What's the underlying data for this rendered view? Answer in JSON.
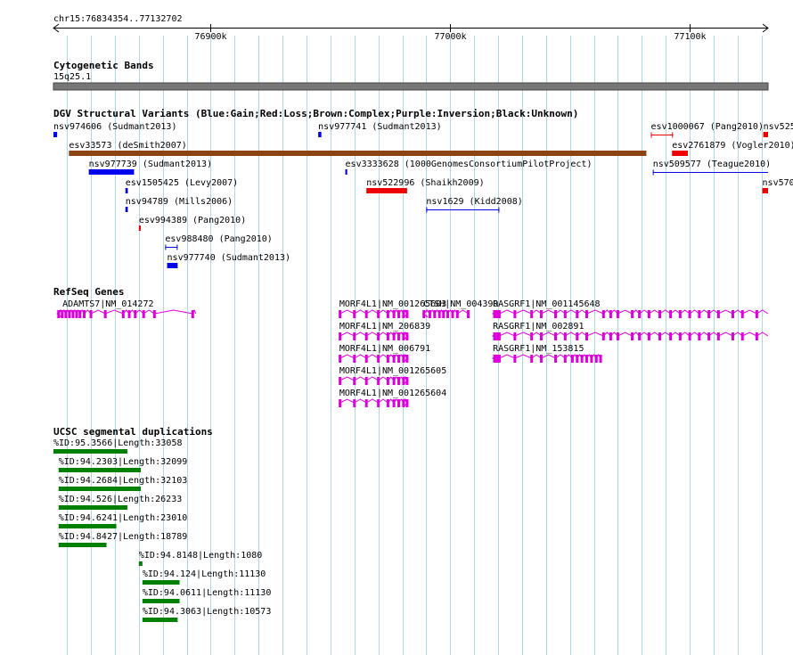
{
  "header": {
    "location": "chr15:76834354..77132702",
    "ticks": [
      {
        "pos": 76900000,
        "label": "76900k"
      },
      {
        "pos": 77000000,
        "label": "77000k"
      },
      {
        "pos": 77100000,
        "label": "77100k"
      }
    ]
  },
  "view": {
    "start": 76834354,
    "end": 77132702
  },
  "colors": {
    "gain": "#0000ee",
    "loss": "#ee0000",
    "complex": "#8b4513",
    "gene": "#dd00dd",
    "segdup": "#008000",
    "band": "#777777",
    "grid": "#add8e6"
  },
  "tracks": {
    "cyto": {
      "title": "Cytogenetic Bands",
      "band_label": "15q25.1"
    },
    "dgv": {
      "title": "DGV Structural Variants (Blue:Gain;Red:Loss;Brown:Complex;Purple:Inversion;Black:Unknown)",
      "features": [
        {
          "label": "nsv974606 (Sudmant2013)",
          "start": 76834354,
          "end": 76835900,
          "row": 0,
          "type": "gain",
          "style": "box"
        },
        {
          "label": "nsv977741 (Sudmant2013)",
          "start": 76944900,
          "end": 76946200,
          "row": 0,
          "type": "gain",
          "style": "box"
        },
        {
          "label": "esv1000067 (Pang2010)",
          "start": 77083800,
          "end": 77093000,
          "row": 0,
          "type": "loss",
          "style": "span"
        },
        {
          "label": "nsv525",
          "start": 77130700,
          "end": 77132702,
          "row": 0,
          "type": "loss",
          "style": "box"
        },
        {
          "label": "esv33573 (deSmith2007)",
          "start": 76840800,
          "end": 77081900,
          "row": 1,
          "type": "complex",
          "style": "box"
        },
        {
          "label": "esv2761879 (Vogler2010)",
          "start": 77092600,
          "end": 77099200,
          "row": 1,
          "type": "loss",
          "style": "box"
        },
        {
          "label": "nsv977739 (Sudmant2013)",
          "start": 76849100,
          "end": 76868000,
          "row": 2,
          "type": "gain",
          "style": "box"
        },
        {
          "label": "esv3333628 (1000GenomesConsortiumPilotProject)",
          "start": 76956200,
          "end": 76957000,
          "row": 2,
          "type": "gain",
          "style": "box"
        },
        {
          "label": "nsv509577 (Teague2010)",
          "start": 77084600,
          "end": 77132702,
          "row": 2,
          "type": "gain",
          "style": "span"
        },
        {
          "label": "esv1505425 (Levy2007)",
          "start": 76864400,
          "end": 76865400,
          "row": 3,
          "type": "gain",
          "style": "box"
        },
        {
          "label": "nsv522996 (Shaikh2009)",
          "start": 76965000,
          "end": 76982000,
          "row": 3,
          "type": "loss",
          "style": "box"
        },
        {
          "label": "nsv570",
          "start": 77130300,
          "end": 77132702,
          "row": 3,
          "type": "loss",
          "style": "box"
        },
        {
          "label": "nsv94789 (Mills2006)",
          "start": 76864400,
          "end": 76865400,
          "row": 4,
          "type": "gain",
          "style": "box"
        },
        {
          "label": "nsv1629 (Kidd2008)",
          "start": 76990000,
          "end": 77020500,
          "row": 4,
          "type": "gain",
          "style": "span"
        },
        {
          "label": "esv994389 (Pang2010)",
          "start": 76870000,
          "end": 76870800,
          "row": 5,
          "type": "loss",
          "style": "box"
        },
        {
          "label": "esv988480 (Pang2010)",
          "start": 76881000,
          "end": 76886200,
          "row": 6,
          "type": "gain",
          "style": "span"
        },
        {
          "label": "nsv977740 (Sudmant2013)",
          "start": 76881800,
          "end": 76886200,
          "row": 7,
          "type": "gain",
          "style": "box"
        }
      ]
    },
    "refseq": {
      "title": "RefSeq Genes",
      "genes": [
        {
          "label": "ADAMTS7|NM_014272",
          "start": 76835900,
          "end": 76893800,
          "row": 0,
          "strand": "-",
          "exons": [
            76836500,
            76838000,
            76839500,
            76841000,
            76842500,
            76844000,
            76845400,
            76847200,
            76850000,
            76856000,
            76863500,
            76866000,
            76868500,
            76872000,
            76876500,
            76892500
          ]
        },
        {
          "label": "MORF4L1|NM_001265603",
          "start": 76953700,
          "end": 76982400,
          "row": 0,
          "strand": "+",
          "exons": [
            76954000,
            76960000,
            76965000,
            76970000,
            76974000,
            76976500,
            76978500,
            76980500,
            76982000
          ]
        },
        {
          "label": "CTSH|NM_004390",
          "start": 76988800,
          "end": 77008500,
          "row": 0,
          "strand": "-",
          "exons": [
            76989000,
            76991500,
            76993500,
            76995500,
            76997200,
            76999000,
            77001000,
            77003000,
            77007500
          ]
        },
        {
          "label": "RASGRF1|NM_001145648",
          "start": 77017800,
          "end": 77132702,
          "row": 0,
          "strand": "-",
          "exons": [
            77018500,
            77019500,
            77020500,
            77027000,
            77034000,
            77038000,
            77044000,
            77048000,
            77053000,
            77057000,
            77064000,
            77067000,
            77070000,
            77076000,
            77079000,
            77083000,
            77087500,
            77092000,
            77096000,
            77100000,
            77104000,
            77108000,
            77112000,
            77118000,
            77122000,
            77128000
          ]
        },
        {
          "label": "MORF4L1|NM_206839",
          "start": 76953700,
          "end": 76982400,
          "row": 1,
          "strand": "+",
          "exons": [
            76954000,
            76960000,
            76965000,
            76970000,
            76974000,
            76976500,
            76978500,
            76980500,
            76982000
          ]
        },
        {
          "label": "RASGRF1|NM_002891",
          "start": 77017800,
          "end": 77132702,
          "row": 1,
          "strand": "-",
          "exons": [
            77018500,
            77019500,
            77020500,
            77027000,
            77034000,
            77038000,
            77044000,
            77048000,
            77053000,
            77057000,
            77064000,
            77067000,
            77070000,
            77076000,
            77079000,
            77083000,
            77087500,
            77092000,
            77096000,
            77100000,
            77104000,
            77108000,
            77112000,
            77118000,
            77122000,
            77128000
          ]
        },
        {
          "label": "MORF4L1|NM_006791",
          "start": 76953700,
          "end": 76982400,
          "row": 2,
          "strand": "+",
          "exons": [
            76954000,
            76960000,
            76965000,
            76970000,
            76974000,
            76976500,
            76978500,
            76980500,
            76982000
          ]
        },
        {
          "label": "RASGRF1|NM_153815",
          "start": 77017800,
          "end": 77063500,
          "row": 2,
          "strand": "-",
          "exons": [
            77018500,
            77019500,
            77020500,
            77027000,
            77034000,
            77038000,
            77044000,
            77048000,
            77051000,
            77053000,
            77055000,
            77057000,
            77059000,
            77061000,
            77062800
          ]
        },
        {
          "label": "MORF4L1|NM_001265605",
          "start": 76953700,
          "end": 76982400,
          "row": 3,
          "strand": "+",
          "exons": [
            76954000,
            76960000,
            76965000,
            76970000,
            76974000,
            76976500,
            76978500,
            76980500,
            76982000
          ]
        },
        {
          "label": "MORF4L1|NM_001265604",
          "start": 76953700,
          "end": 76982400,
          "row": 4,
          "strand": "+",
          "exons": [
            76954000,
            76960000,
            76965000,
            76970000,
            76974000,
            76976500,
            76978500,
            76980500,
            76982000
          ]
        }
      ]
    },
    "segdup": {
      "title": "UCSC segmental duplications",
      "features": [
        {
          "label": "%ID:95.3566|Length:33058",
          "start": 76834354,
          "end": 76865200,
          "row": 0
        },
        {
          "label": "%ID:94.2303|Length:32099",
          "start": 76836500,
          "end": 76870800,
          "row": 1
        },
        {
          "label": "%ID:94.2684|Length:32103",
          "start": 76836500,
          "end": 76870800,
          "row": 2
        },
        {
          "label": "%ID:94.526|Length:26233",
          "start": 76836500,
          "end": 76865200,
          "row": 3
        },
        {
          "label": "%ID:94.6241|Length:23010",
          "start": 76836500,
          "end": 76860600,
          "row": 4
        },
        {
          "label": "%ID:94.8427|Length:18789",
          "start": 76836500,
          "end": 76856500,
          "row": 5
        },
        {
          "label": "%ID:94.8148|Length:1080",
          "start": 76870000,
          "end": 76871500,
          "row": 6
        },
        {
          "label": "%ID:94.124|Length:11130",
          "start": 76871500,
          "end": 76887000,
          "row": 7
        },
        {
          "label": "%ID:94.0611|Length:11130",
          "start": 76871500,
          "end": 76887000,
          "row": 8
        },
        {
          "label": "%ID:94.3063|Length:10573",
          "start": 76871500,
          "end": 76886200,
          "row": 9
        }
      ]
    }
  }
}
